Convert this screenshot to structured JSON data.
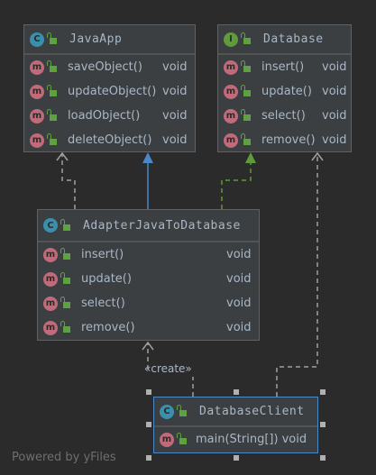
{
  "classes": {
    "java_app": {
      "kind": "C",
      "name": "JavaApp",
      "methods": [
        {
          "name": "saveObject()",
          "type": "void"
        },
        {
          "name": "updateObject()",
          "type": "void"
        },
        {
          "name": "loadObject()",
          "type": "void"
        },
        {
          "name": "deleteObject()",
          "type": "void"
        }
      ]
    },
    "database": {
      "kind": "I",
      "name": "Database",
      "methods": [
        {
          "name": "insert()",
          "type": "void"
        },
        {
          "name": "update()",
          "type": "void"
        },
        {
          "name": "select()",
          "type": "void"
        },
        {
          "name": "remove()",
          "type": "void"
        }
      ]
    },
    "adapter": {
      "kind": "C",
      "name": "AdapterJavaToDatabase",
      "methods": [
        {
          "name": "insert()",
          "type": "void"
        },
        {
          "name": "update()",
          "type": "void"
        },
        {
          "name": "select()",
          "type": "void"
        },
        {
          "name": "remove()",
          "type": "void"
        }
      ]
    },
    "client": {
      "kind": "C",
      "name": "DatabaseClient",
      "methods": [
        {
          "name": "main(String[])",
          "type": "void"
        }
      ]
    }
  },
  "method_badge": "m",
  "create_label": "«create»",
  "footer": "Powered by yFiles",
  "colors": {
    "background": "#2b2b2b",
    "box": "#3c3f41",
    "realization": "#5f9a3c",
    "inheritance": "#4a88c7",
    "selection": "#4a88c7"
  }
}
